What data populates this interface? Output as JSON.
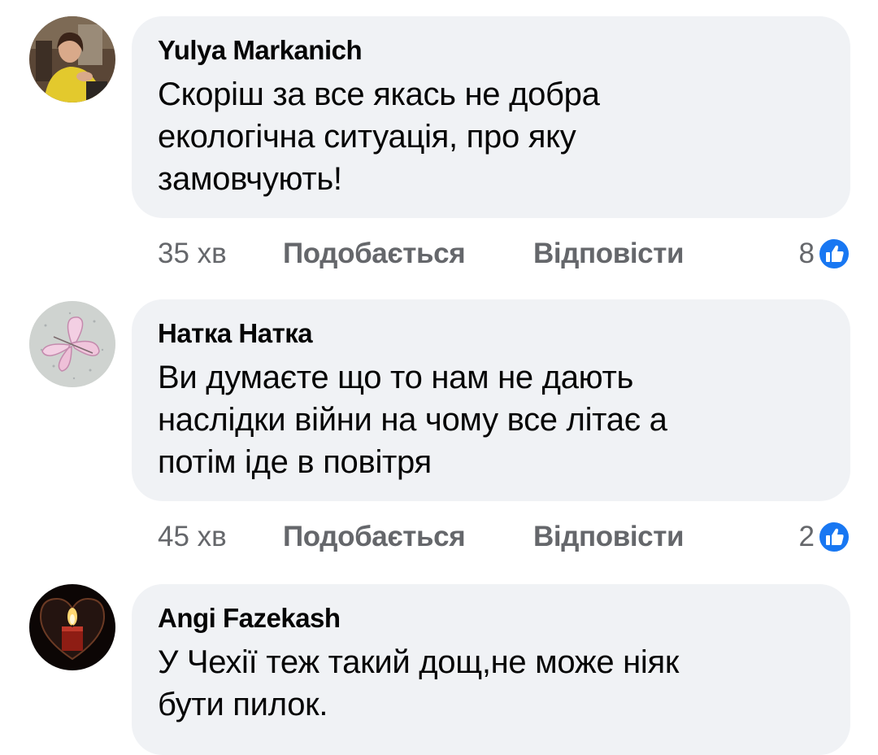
{
  "colors": {
    "bubble_bg": "#f0f2f5",
    "meta_text": "#65676b",
    "like_blue": "#1877f2"
  },
  "comments": [
    {
      "author": "Yulya Markanich",
      "text": "Скоріш за все якась не добра\nекологічна ситуація,  про яку\nзамовчують!",
      "time": "35 хв",
      "like_label": "Подобається",
      "reply_label": "Відповісти",
      "reaction_count": "8",
      "reaction_icon": "like-thumb-icon"
    },
    {
      "author": "Натка Натка",
      "text": "Ви думаєте що то нам не дають\nнаслідки війни на чому все літає а\nпотім іде в повітря",
      "time": "45 хв",
      "like_label": "Подобається",
      "reply_label": "Відповісти",
      "reaction_count": "2",
      "reaction_icon": "like-thumb-icon"
    },
    {
      "author": "Angi Fazekash",
      "text": "У Чехії теж такий дощ,не може ніяк\nбути пилок."
    }
  ]
}
